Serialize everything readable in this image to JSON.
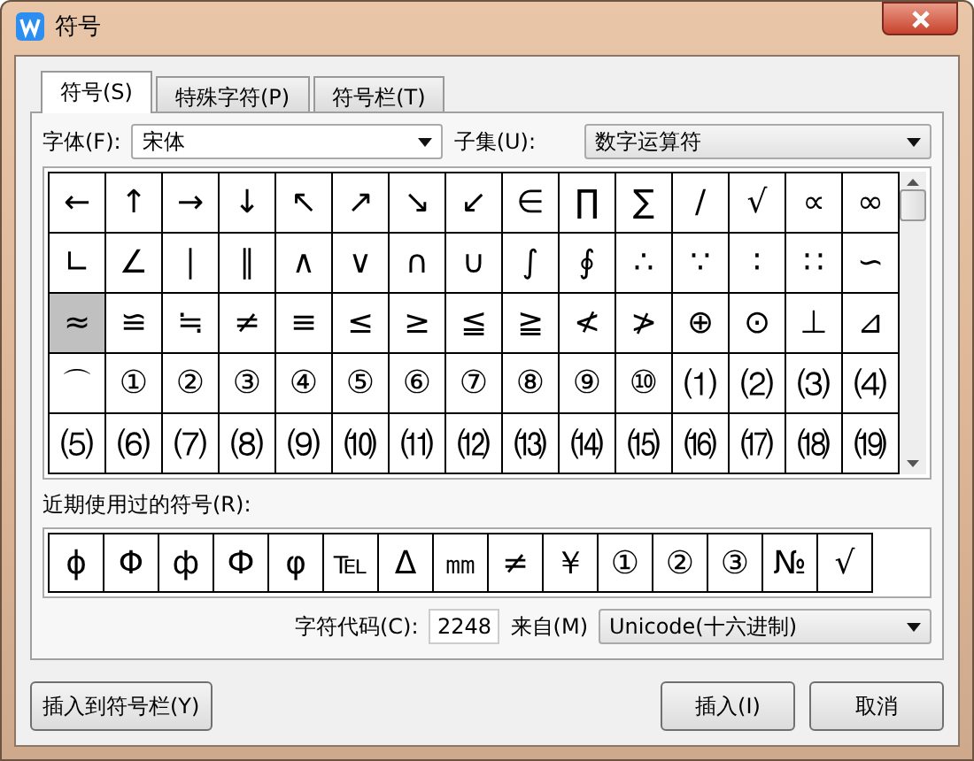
{
  "window": {
    "title": "符号"
  },
  "tabs": [
    {
      "label": "符号(S)",
      "selected": true
    },
    {
      "label": "特殊字符(P)",
      "selected": false
    },
    {
      "label": "符号栏(T)",
      "selected": false
    }
  ],
  "font": {
    "label": "字体(F):",
    "value": "宋体"
  },
  "subset": {
    "label": "子集(U):",
    "value": "数字运算符"
  },
  "symbols": [
    {
      "char": "←",
      "selected": false
    },
    {
      "char": "↑",
      "selected": false
    },
    {
      "char": "→",
      "selected": false
    },
    {
      "char": "↓",
      "selected": false
    },
    {
      "char": "↖",
      "selected": false
    },
    {
      "char": "↗",
      "selected": false
    },
    {
      "char": "↘",
      "selected": false
    },
    {
      "char": "↙",
      "selected": false
    },
    {
      "char": "∈",
      "selected": false
    },
    {
      "char": "∏",
      "selected": false
    },
    {
      "char": "∑",
      "selected": false
    },
    {
      "char": "∕",
      "selected": false
    },
    {
      "char": "√",
      "selected": false
    },
    {
      "char": "∝",
      "selected": false
    },
    {
      "char": "∞",
      "selected": false
    },
    {
      "char": "∟",
      "selected": false
    },
    {
      "char": "∠",
      "selected": false
    },
    {
      "char": "∣",
      "selected": false
    },
    {
      "char": "∥",
      "selected": false
    },
    {
      "char": "∧",
      "selected": false
    },
    {
      "char": "∨",
      "selected": false
    },
    {
      "char": "∩",
      "selected": false
    },
    {
      "char": "∪",
      "selected": false
    },
    {
      "char": "∫",
      "selected": false
    },
    {
      "char": "∮",
      "selected": false
    },
    {
      "char": "∴",
      "selected": false
    },
    {
      "char": "∵",
      "selected": false
    },
    {
      "char": "∶",
      "selected": false
    },
    {
      "char": "∷",
      "selected": false
    },
    {
      "char": "∽",
      "selected": false
    },
    {
      "char": "≈",
      "selected": true
    },
    {
      "char": "≌",
      "selected": false
    },
    {
      "char": "≒",
      "selected": false
    },
    {
      "char": "≠",
      "selected": false
    },
    {
      "char": "≡",
      "selected": false
    },
    {
      "char": "≤",
      "selected": false
    },
    {
      "char": "≥",
      "selected": false
    },
    {
      "char": "≦",
      "selected": false
    },
    {
      "char": "≧",
      "selected": false
    },
    {
      "char": "≮",
      "selected": false
    },
    {
      "char": "≯",
      "selected": false
    },
    {
      "char": "⊕",
      "selected": false
    },
    {
      "char": "⊙",
      "selected": false
    },
    {
      "char": "⊥",
      "selected": false
    },
    {
      "char": "⊿",
      "selected": false
    },
    {
      "char": "⌒",
      "selected": false
    },
    {
      "char": "①",
      "selected": false
    },
    {
      "char": "②",
      "selected": false
    },
    {
      "char": "③",
      "selected": false
    },
    {
      "char": "④",
      "selected": false
    },
    {
      "char": "⑤",
      "selected": false
    },
    {
      "char": "⑥",
      "selected": false
    },
    {
      "char": "⑦",
      "selected": false
    },
    {
      "char": "⑧",
      "selected": false
    },
    {
      "char": "⑨",
      "selected": false
    },
    {
      "char": "⑩",
      "selected": false
    },
    {
      "char": "⑴",
      "selected": false
    },
    {
      "char": "⑵",
      "selected": false
    },
    {
      "char": "⑶",
      "selected": false
    },
    {
      "char": "⑷",
      "selected": false
    },
    {
      "char": "⑸",
      "selected": false
    },
    {
      "char": "⑹",
      "selected": false
    },
    {
      "char": "⑺",
      "selected": false
    },
    {
      "char": "⑻",
      "selected": false
    },
    {
      "char": "⑼",
      "selected": false
    },
    {
      "char": "⑽",
      "selected": false
    },
    {
      "char": "⑾",
      "selected": false
    },
    {
      "char": "⑿",
      "selected": false
    },
    {
      "char": "⒀",
      "selected": false
    },
    {
      "char": "⒁",
      "selected": false
    },
    {
      "char": "⒂",
      "selected": false
    },
    {
      "char": "⒃",
      "selected": false
    },
    {
      "char": "⒄",
      "selected": false
    },
    {
      "char": "⒅",
      "selected": false
    },
    {
      "char": "⒆",
      "selected": false
    }
  ],
  "recent": {
    "label": "近期使用过的符号(R):",
    "symbols": [
      "ɸ",
      "Φ",
      "ф",
      "Ф",
      "φ",
      "℡",
      "Δ",
      "㎜",
      "≠",
      "￥",
      "①",
      "②",
      "③",
      "№",
      "√"
    ]
  },
  "code": {
    "label": "字符代码(C):",
    "value": "2248",
    "from_label": "来自(M)",
    "from_value": "Unicode(十六进制)"
  },
  "buttons": [
    {
      "label": "插入到符号栏(Y)"
    },
    {
      "label": "插入(I)"
    },
    {
      "label": "取消"
    }
  ]
}
